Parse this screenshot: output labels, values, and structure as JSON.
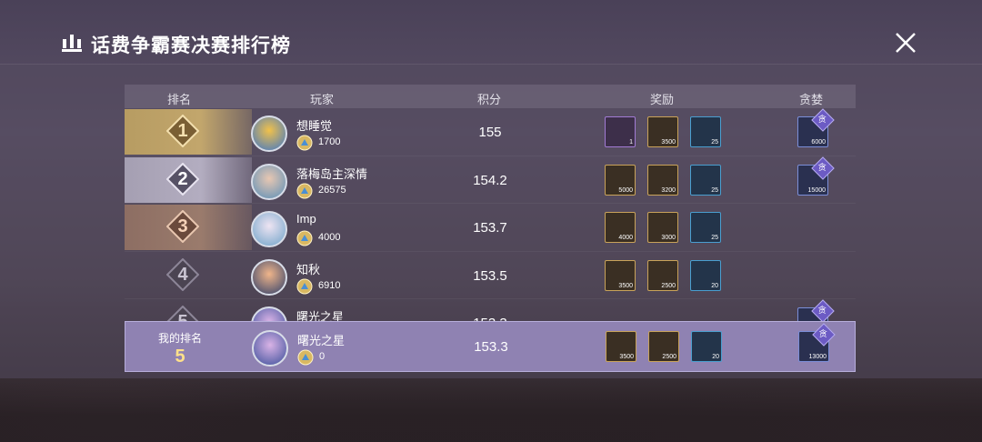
{
  "title": "话费争霸赛决赛排行榜",
  "headers": {
    "rank": "排名",
    "player": "玩家",
    "score": "积分",
    "reward": "奖励",
    "greed": "贪婪"
  },
  "rows": [
    {
      "rank": "1",
      "name": "想睡觉",
      "coins": "1700",
      "score": "155",
      "rewards": [
        {
          "type": "purple",
          "count": "1"
        },
        {
          "type": "gold",
          "count": "3500"
        },
        {
          "type": "cyan",
          "count": "25"
        }
      ],
      "greed": {
        "tag": "贪",
        "count": "6000"
      }
    },
    {
      "rank": "2",
      "name": "落梅岛主深情",
      "coins": "26575",
      "score": "154.2",
      "rewards": [
        {
          "type": "gold",
          "count": "5000"
        },
        {
          "type": "gold",
          "count": "3200"
        },
        {
          "type": "cyan",
          "count": "25"
        }
      ],
      "greed": {
        "tag": "贪",
        "count": "15000"
      }
    },
    {
      "rank": "3",
      "name": "Imp",
      "coins": "4000",
      "score": "153.7",
      "rewards": [
        {
          "type": "gold",
          "count": "4000"
        },
        {
          "type": "gold",
          "count": "3000"
        },
        {
          "type": "cyan",
          "count": "25"
        }
      ]
    },
    {
      "rank": "4",
      "name": "知秋",
      "coins": "6910",
      "score": "153.5",
      "rewards": [
        {
          "type": "gold",
          "count": "3500"
        },
        {
          "type": "gold",
          "count": "2500"
        },
        {
          "type": "cyan",
          "count": "20"
        }
      ]
    },
    {
      "rank": "5",
      "name": "曙光之星",
      "coins": "",
      "score": "153.3",
      "rewards": [],
      "greed": {
        "tag": "贪",
        "count": ""
      }
    }
  ],
  "my": {
    "label": "我的排名",
    "rank": "5",
    "name": "曙光之星",
    "coins": "0",
    "score": "153.3",
    "rewards": [
      {
        "type": "gold",
        "count": "3500"
      },
      {
        "type": "gold",
        "count": "2500"
      },
      {
        "type": "cyan",
        "count": "20"
      }
    ],
    "greed": {
      "tag": "贪",
      "count": "13000"
    }
  },
  "colors": {
    "gold": "#c2a66c",
    "silver": "#b3adc0",
    "bronze": "#9a7b6c",
    "my_row": "#8f82b2",
    "my_rank": "#ffe08a"
  },
  "icons": {
    "title": "bar-chart-icon",
    "close": "close-icon",
    "coin": "coin-icon",
    "rank": "diamond-badge-icon"
  }
}
